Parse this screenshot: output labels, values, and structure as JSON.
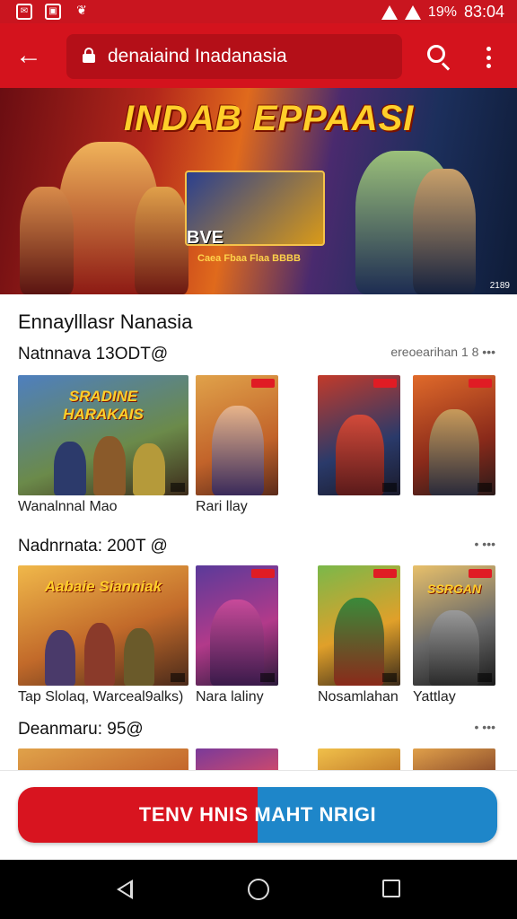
{
  "status_bar": {
    "battery": "19%",
    "time": "83:04"
  },
  "toolbar": {
    "url": "denaiaind Inadanasia"
  },
  "banner": {
    "title": "INDAB EPPAASI",
    "caption_main": "BVE",
    "caption_sub": "Caea Fbaa Flaa BBBB",
    "corner_mark": "2189"
  },
  "main": {
    "section_title": "Ennaylllasr Nanasia",
    "rows": [
      {
        "title": "Natnnava 13ODT@",
        "more": "ereoearihan 1 8 •••",
        "captions": [
          "Wanalnnal Mao",
          "Rari llay"
        ]
      },
      {
        "title": "Nadnrnata: 200T @",
        "more": "• •••",
        "captions": [
          "Tap Slolaq, Warceal9alks)",
          "Nara laliny",
          "Nosamlahan",
          "Yattlay"
        ]
      },
      {
        "title": "Deanmaru: 95@",
        "more": "• •••",
        "captions": []
      }
    ],
    "tile_logos": [
      "SRADINE HARAKAIS",
      "Aabaie Sianniak",
      "SSRGAN"
    ]
  },
  "cta": {
    "label": "TENV HNIS MAHT NRIGI"
  },
  "colors": {
    "brand_red": "#d4131d",
    "cta_blue": "#1e86c9"
  }
}
